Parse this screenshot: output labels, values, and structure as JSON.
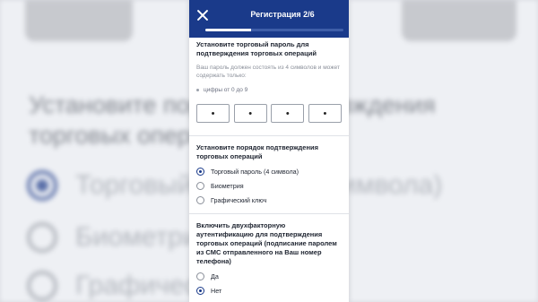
{
  "header": {
    "title": "Регистрация 2/6",
    "progress": 0.33
  },
  "password": {
    "title": "Установите торговый пароль для подтверждения торговых операций",
    "hint": "Ваш пароль должен состоять из 4 символов и может содержать только:",
    "rule": "цифры от 0 до 9",
    "digits": [
      "•",
      "•",
      "•",
      "•"
    ]
  },
  "confirm_order": {
    "title": "Установите порядок подтверждения торговых операций",
    "options": [
      "Торговый пароль (4 символа)",
      "Биометрия",
      "Графический ключ"
    ],
    "selected_index": 0
  },
  "two_factor": {
    "title": "Включить двухфакторную аутентификацию для подтверждения торговых операций (подписание паролем из СМС отправленного на Ваш номер телефона)",
    "options": [
      "Да",
      "Нет"
    ],
    "selected_index": 1
  },
  "colors": {
    "brand": "#1a3a8a"
  }
}
